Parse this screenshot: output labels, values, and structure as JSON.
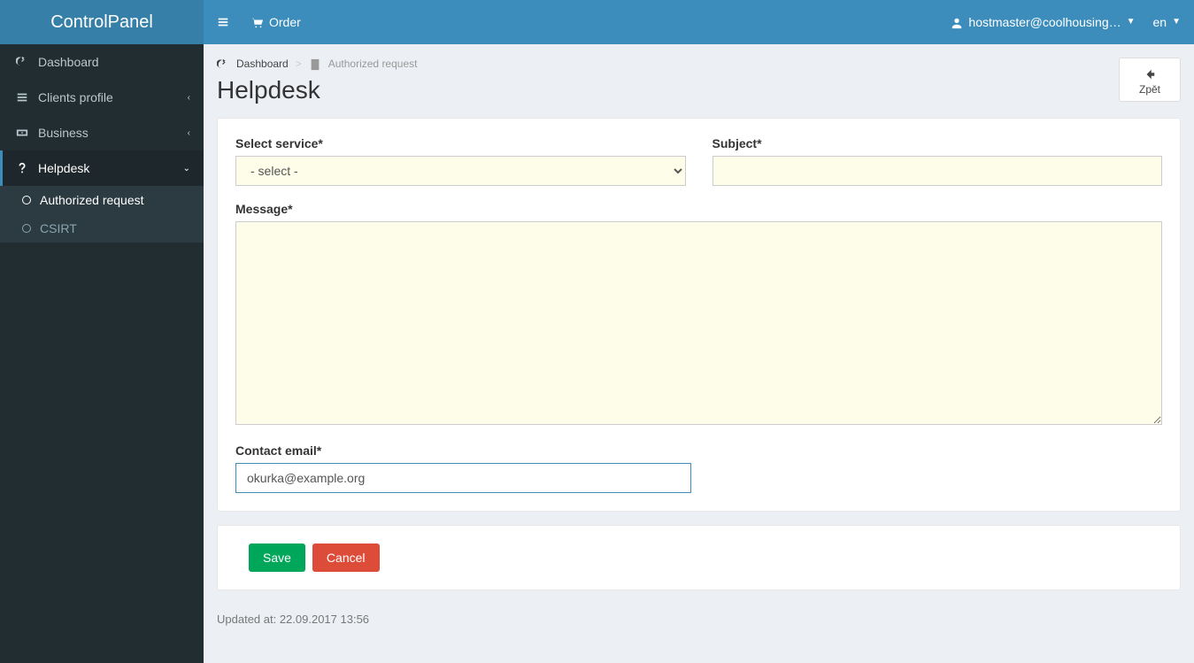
{
  "brand": "ControlPanel",
  "navbar": {
    "order_label": "Order",
    "user_label": "hostmaster@coolhousing…",
    "lang_label": "en"
  },
  "sidebar": {
    "items": [
      {
        "label": "Dashboard"
      },
      {
        "label": "Clients profile"
      },
      {
        "label": "Business"
      },
      {
        "label": "Helpdesk"
      }
    ],
    "helpdesk_sub": [
      {
        "label": "Authorized request"
      },
      {
        "label": "CSIRT"
      }
    ]
  },
  "breadcrumb": {
    "root": "Dashboard",
    "current": "Authorized request"
  },
  "page": {
    "title": "Helpdesk",
    "back_label": "Zpět"
  },
  "form": {
    "select_service_label": "Select service*",
    "select_service_value": "- select -",
    "subject_label": "Subject*",
    "subject_value": "",
    "message_label": "Message*",
    "message_value": "",
    "contact_email_label": "Contact email*",
    "contact_email_value": "okurka@example.org",
    "save_label": "Save",
    "cancel_label": "Cancel"
  },
  "footer": {
    "updated_prefix": "Updated at: ",
    "updated_value": "22.09.2017 13:56"
  }
}
